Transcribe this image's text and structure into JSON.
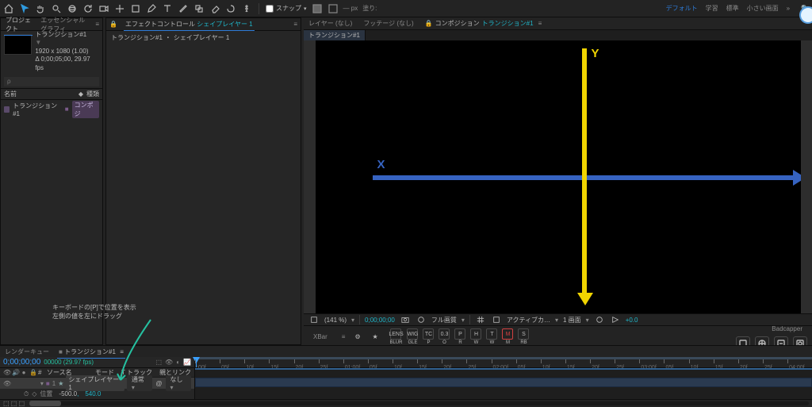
{
  "workspaces": {
    "default": "デフォルト",
    "learn": "学習",
    "standard": "標準",
    "small": "小さい画面"
  },
  "toolbar": {
    "snap_label": "スナップ"
  },
  "project": {
    "tab": "プロジェクト",
    "eg_tab": "エッセンシャルグラフィ",
    "item_name": "トランジション#1",
    "meta_line1": "1920 x 1080 (1.00)",
    "meta_line2": "Δ 0;00;05;00, 29.97 fps",
    "header_name": "名前",
    "header_type": "種類",
    "row_type": "コンポジ"
  },
  "fx": {
    "tab": "エフェクトコントロール",
    "layer_link": "シェイプレイヤー 1",
    "crumb_comp": "トランジション#1",
    "crumb_layer": "シェイプレイヤー 1"
  },
  "viewer": {
    "tab_layer": "レイヤー (なし)",
    "tab_footage": "フッテージ (なし)",
    "tab_comp_prefix": "コンポジション",
    "tab_comp_name": "トランジション#1",
    "subtab": "トランジション#1",
    "x_label": "X",
    "y_label": "Y",
    "footer": {
      "zoom": "(141 %)",
      "time": "0;00;00;00",
      "full_label": "フル画質",
      "active_cam": "アクティブカ…",
      "views": "1 画面"
    }
  },
  "quickbar": {
    "xbar": "XBar",
    "items": [
      {
        "top": "LENS",
        "bot": "BLUR"
      },
      {
        "top": "WIG",
        "bot": "GLE"
      },
      {
        "top": "TC",
        "bot": "P"
      },
      {
        "top": "0.3",
        "bot": "O"
      },
      {
        "top": "P",
        "bot": "R"
      },
      {
        "top": "H",
        "bot": "W"
      },
      {
        "top": "T",
        "bot": "W"
      },
      {
        "top": "M",
        "bot": "M",
        "cls": "red"
      },
      {
        "top": "S",
        "bot": "RB"
      }
    ],
    "badcapper": "Badcapper"
  },
  "annotation": {
    "line1": "キーボードの[P]で位置を表示",
    "line2": "左側の値を左にドラッグ"
  },
  "timeline": {
    "tab_renderq": "レンダーキュー",
    "tab_comp": "トランジション#1",
    "timecode": "0;00;00;00",
    "timecode_frames": "00000 (29.97 fps)",
    "search_ph": "ρ",
    "col_src": "ソース名",
    "col_mode": "モード",
    "col_trk": "T トラック",
    "col_parent": "親とリンク",
    "layer1_num": "1",
    "layer1_name": "シェイプレイヤー 1",
    "layer1_mode": "通常",
    "parent_none": "なし",
    "prop_position": "位置",
    "prop_pos_x": "-500.0",
    "prop_pos_y": "540.0",
    "ruler": [
      ":00f",
      "05f",
      "10f",
      "15f",
      "20f",
      "25f",
      "01:00f",
      "05f",
      "10f",
      "15f",
      "20f",
      "25f",
      "02:00f",
      "05f",
      "10f",
      "15f",
      "20f",
      "25f",
      "03:00f",
      "05f",
      "10f",
      "15f",
      "20f",
      "25f",
      "04:00f"
    ]
  }
}
